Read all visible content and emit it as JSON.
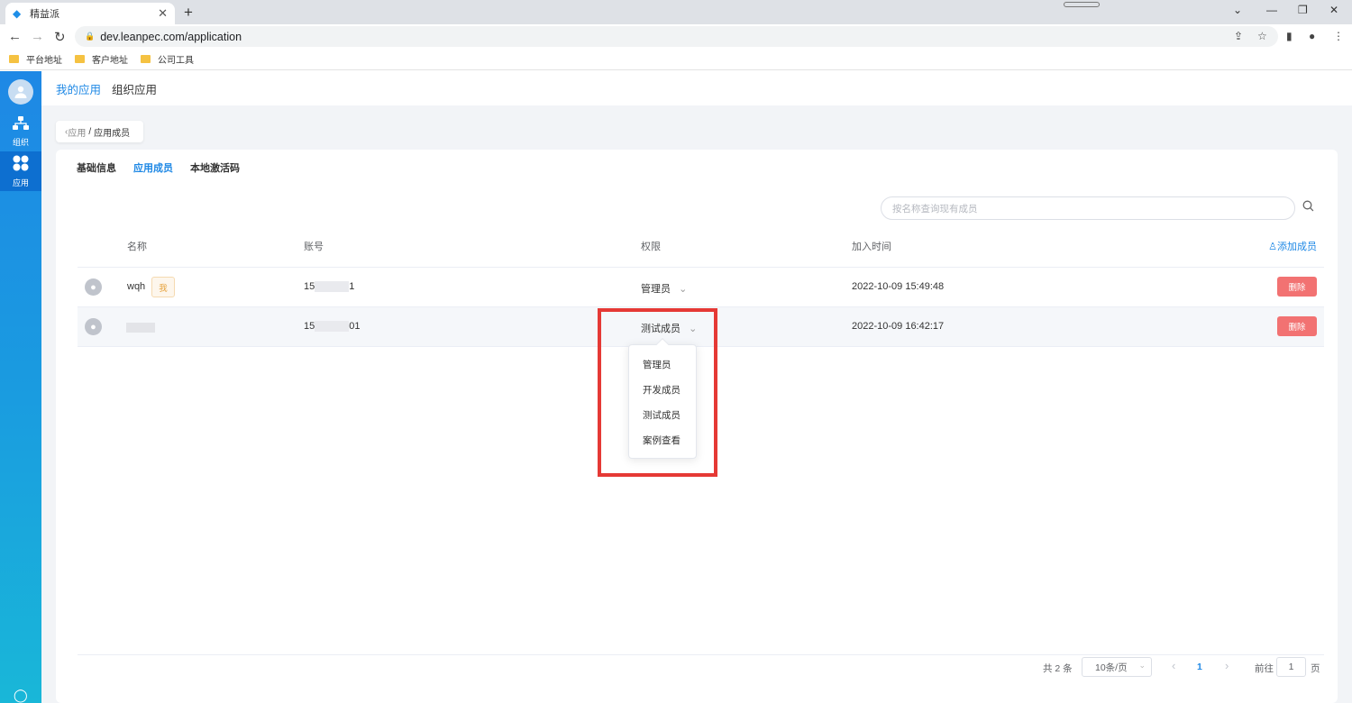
{
  "browser": {
    "tab_title": "精益派",
    "tab_close": "✕",
    "new_tab": "+",
    "url": "dev.leanpec.com/application",
    "bookmarks": [
      "平台地址",
      "客户地址",
      "公司工具"
    ]
  },
  "sidebar": {
    "items": [
      {
        "label": "组织",
        "icon": "org-tree-icon"
      },
      {
        "label": "应用",
        "icon": "apps-grid-icon"
      }
    ]
  },
  "topnav": {
    "my_apps": "我的应用",
    "org_apps": "组织应用"
  },
  "breadcrumb": {
    "parent": "应用",
    "separator": "/",
    "current": "应用成员"
  },
  "tabs": [
    "基础信息",
    "应用成员",
    "本地激活码"
  ],
  "search": {
    "placeholder": "按名称查询现有成员"
  },
  "table": {
    "headers": {
      "name": "名称",
      "account": "账号",
      "role": "权限",
      "join_time": "加入时间"
    },
    "add_member": "添加成员",
    "rows": [
      {
        "name": "wqh",
        "me_badge": "我",
        "account_prefix": "15",
        "account_suffix": "1",
        "role": "管理员",
        "join_time": "2022-10-09 15:49:48",
        "delete": "删除"
      },
      {
        "name": "",
        "account_prefix": "15",
        "account_suffix": "01",
        "role": "测试成员",
        "join_time": "2022-10-09 16:42:17",
        "delete": "删除"
      }
    ]
  },
  "role_dropdown": {
    "options": [
      "管理员",
      "开发成员",
      "测试成员",
      "案例查看"
    ]
  },
  "pagination": {
    "total": "共 2 条",
    "page_size": "10条/页",
    "prev": "‹",
    "current": "1",
    "next": "›",
    "goto_label": "前往",
    "goto_value": "1",
    "page_unit": "页"
  },
  "colors": {
    "primary": "#1e88e5",
    "danger": "#f27272",
    "highlight_box": "#e53935"
  }
}
